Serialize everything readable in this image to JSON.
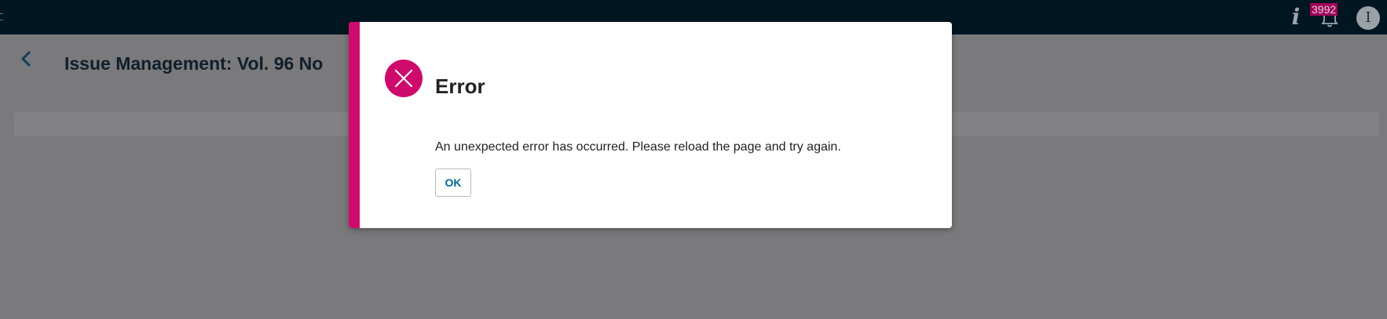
{
  "topbar": {
    "notification_count": "3992",
    "avatar_initial": "I",
    "help_glyph": "i",
    "icons": [
      "help-icon",
      "bell-icon",
      "avatar"
    ]
  },
  "page": {
    "back_glyph": "‹",
    "title": "Issue Management: Vol. 96 No"
  },
  "dialog": {
    "title": "Error",
    "message": "An unexpected error has occurred. Please reload the page and try again.",
    "ok_label": "OK",
    "icon": "error-x-icon"
  },
  "colors": {
    "topbar_bg": "#001621",
    "accent": "#d00a6c",
    "link": "#006798",
    "badge": "#a3005a",
    "overlay_bg": "#7a7a7c"
  }
}
